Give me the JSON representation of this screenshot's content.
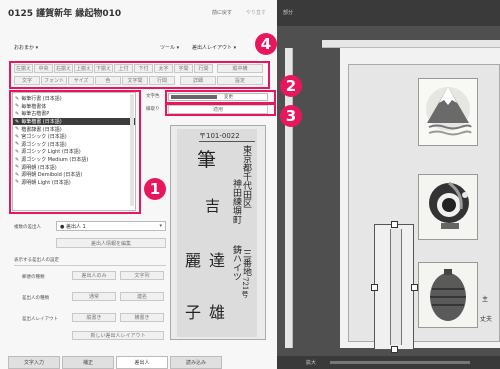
{
  "app": {
    "title": "0125 謹賀新年 縁起物010",
    "top_right_btn1": "前に戻す",
    "top_right_btn2": "やり直す",
    "preview_label": "部分",
    "menu_left": "おおまか ▾",
    "menu_tool": "ツール ▾",
    "menu_layout": "差出人レイアウト ▾"
  },
  "toolbar": {
    "row1": [
      "左揃え",
      "中央",
      "右揃え",
      "上揃え",
      "下揃え",
      "上付",
      "下付",
      "太字",
      "字間",
      "行間"
    ],
    "row1_wide": "縦中横",
    "row2": [
      "文字",
      "フォント",
      "サイズ",
      "色",
      "文字間",
      "行間"
    ],
    "row2_wide1": "詳細",
    "row2_wide2": "設定"
  },
  "font_list": {
    "items": [
      {
        "label": "毎筆行書 (日本語)",
        "selected": false
      },
      {
        "label": "毎筆楷書体",
        "selected": false
      },
      {
        "label": "毎筆古楷書P",
        "selected": false
      },
      {
        "label": "毎筆楷書 (日本語)",
        "selected": true
      },
      {
        "label": "楷書隷書 (日本語)",
        "selected": false
      },
      {
        "label": "宮ゴシック (日本語)",
        "selected": false
      },
      {
        "label": "源ゴシック (日本語)",
        "selected": false
      },
      {
        "label": "源ゴシック Light (日本語)",
        "selected": false
      },
      {
        "label": "源ゴシック Medium (日本語)",
        "selected": false
      },
      {
        "label": "源明朝 (日本語)",
        "selected": false
      },
      {
        "label": "源明朝 Demibold (日本語)",
        "selected": false
      },
      {
        "label": "源明朝 Light (日本語)",
        "selected": false
      }
    ]
  },
  "settings": {
    "color_label": "文字色",
    "size_label": "縁取り",
    "color_btn": "変更",
    "size_btn": "適用"
  },
  "sender": {
    "select_label": "複数の差出人",
    "select_value": "● 差出人 1",
    "edit_btn": "差出人情報を編集",
    "section_label": "表示する差出人の設定",
    "row1_label": "郵便の種類",
    "row1_a": "差出人のみ",
    "row1_b": "文字列",
    "row2_label": "差出人の種類",
    "row2_a": "通常",
    "row2_b": "連名",
    "row3_label": "差出人レイアウト",
    "row3_a": "縦書き",
    "row3_b": "横書き",
    "new_layout_btn": "新しい差出人レイアウト"
  },
  "card": {
    "postal": "〒101-0022",
    "address1": "東京都千代田区",
    "address2": "神田練塀町",
    "address3": "三番地",
    "building": "鋳ハイツ",
    "room": "721号",
    "name1_a": "筆",
    "name1_b": "吉",
    "name2_a": "麗",
    "name2_b": "達",
    "name3_a": "子",
    "name3_b": "雄",
    "preview_name_a": "主",
    "preview_name_b": "丈夫"
  },
  "tabs": [
    "文字入力",
    "補正",
    "差出人",
    "読み込み"
  ],
  "bottom": {
    "zoom_label": "拡大"
  },
  "markers": [
    "1",
    "2",
    "3",
    "4"
  ],
  "colors": {
    "accent": "#e8175d"
  }
}
